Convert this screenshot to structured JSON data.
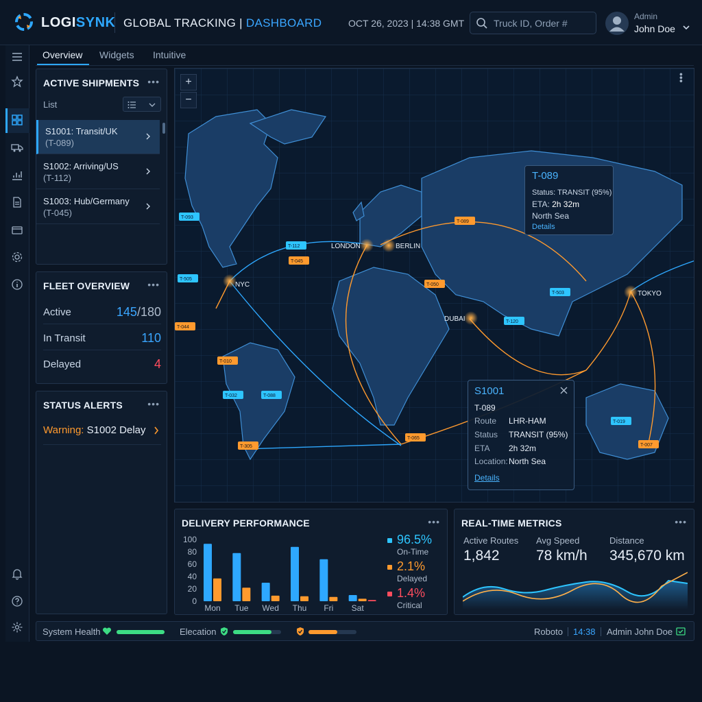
{
  "header": {
    "brand_main": "LOGI",
    "brand_accent": "SYNK",
    "title": "GLOBAL TRACKING | ",
    "title_sub": "DASHBOARD",
    "datetime": "OCT 26, 2023 | 14:38 GMT",
    "search_placeholder": "Truck ID, Order #",
    "user_role": "Admin",
    "user_name": "John Doe"
  },
  "tabs": [
    {
      "label": "Overview",
      "active": true
    },
    {
      "label": "Widgets",
      "active": false
    },
    {
      "label": "Intuitive",
      "active": false
    }
  ],
  "sidebar": {
    "icons": [
      "menu-icon",
      "star-icon",
      "dashboard-icon",
      "truck-icon",
      "chart-icon",
      "document-icon",
      "wallet-icon",
      "settings-icon",
      "info-icon",
      "bell-icon",
      "help-icon",
      "gear-icon"
    ]
  },
  "active_shipments": {
    "title": "ACTIVE SHIPMENTS",
    "view_label": "List",
    "items": [
      {
        "line1": "S1001: Transit/UK",
        "line2": "(T-089)",
        "selected": true
      },
      {
        "line1": "S1002: Arriving/US",
        "line2": "(T-112)",
        "selected": false
      },
      {
        "line1": "S1003: Hub/Germany",
        "line2": "(T-045)",
        "selected": false
      }
    ]
  },
  "fleet": {
    "title": "FLEET OVERVIEW",
    "active_label": "Active",
    "active_value": "145",
    "active_total": "/180",
    "transit_label": "In Transit",
    "transit_value": "110",
    "delayed_label": "Delayed",
    "delayed_value": "4"
  },
  "alerts": {
    "title": "STATUS ALERTS",
    "warning_prefix": "Warning:",
    "warning_text": " S1002 Delay"
  },
  "map": {
    "cities": [
      "LONDON",
      "BERLIN",
      "NYC",
      "DUBAI",
      "TOKYO"
    ],
    "trucks": [
      "T-089",
      "T-045",
      "T-050",
      "T-112",
      "T-503",
      "T-505",
      "T-120",
      "T-044",
      "T-010",
      "T-032",
      "T-088",
      "T-305",
      "T-065",
      "T-019",
      "T-007",
      "T-093"
    ],
    "tooltip_small": {
      "title": "T-089",
      "status": "Status: TRANSIT (95%)",
      "eta_label": "ETA: ",
      "eta_value": "2h 32m",
      "location": "North Sea",
      "link": "Details"
    },
    "tooltip_large": {
      "title": "S1001",
      "truck": "T-089",
      "rows": [
        {
          "label": "Route",
          "value": "LHR-HAM"
        },
        {
          "label": "Status",
          "value": "TRANSIT (95%)"
        },
        {
          "label": "ETA",
          "value": "2h 32m"
        },
        {
          "label": "Location:",
          "value": "North Sea"
        }
      ],
      "link": "Details"
    }
  },
  "delivery": {
    "title": "DELIVERY PERFORMANCE",
    "legend": [
      {
        "value": "96.5%",
        "label": "On-Time",
        "color": "#2ec5ff"
      },
      {
        "value": "2.1%",
        "label": "Delayed",
        "color": "#ff9a2e"
      },
      {
        "value": "1.4%",
        "label": "Critical",
        "color": "#ff4d5e"
      }
    ]
  },
  "chart_data": {
    "type": "bar",
    "title": "DELIVERY PERFORMANCE",
    "categories": [
      "Mon",
      "Tue",
      "Wed",
      "Thu",
      "Fri",
      "Sat"
    ],
    "series": [
      {
        "values": [
          93,
          78,
          30,
          88,
          68,
          10
        ],
        "color": "#2ea8ff"
      },
      {
        "values": [
          37,
          22,
          9,
          8,
          7,
          4
        ],
        "color": "#ff9a2e"
      },
      {
        "values": [
          0,
          0,
          0,
          0,
          0,
          2
        ],
        "color": "#ff4d5e"
      }
    ],
    "yticks": [
      0,
      20,
      40,
      60,
      80,
      100
    ],
    "ylim": [
      0,
      100
    ],
    "grid": false
  },
  "metrics": {
    "title": "REAL-TIME METRICS",
    "items": [
      {
        "label": "Active Routes",
        "value": "1,842"
      },
      {
        "label": "Avg Speed",
        "value": "78 km/h"
      },
      {
        "label": "Distance",
        "value": "345,670 km"
      }
    ]
  },
  "statusbar": {
    "system_health": "System Health",
    "health_level": 1.0,
    "elecation": "Elecation",
    "elecation_level": 0.8,
    "third_level": 0.6,
    "font": "Roboto",
    "time": "14:38",
    "user": "Admin John Doe"
  },
  "colors": {
    "accent": "#2ea8ff",
    "warning": "#ff9a2e",
    "danger": "#ff4d5e",
    "success": "#3ddc84"
  }
}
